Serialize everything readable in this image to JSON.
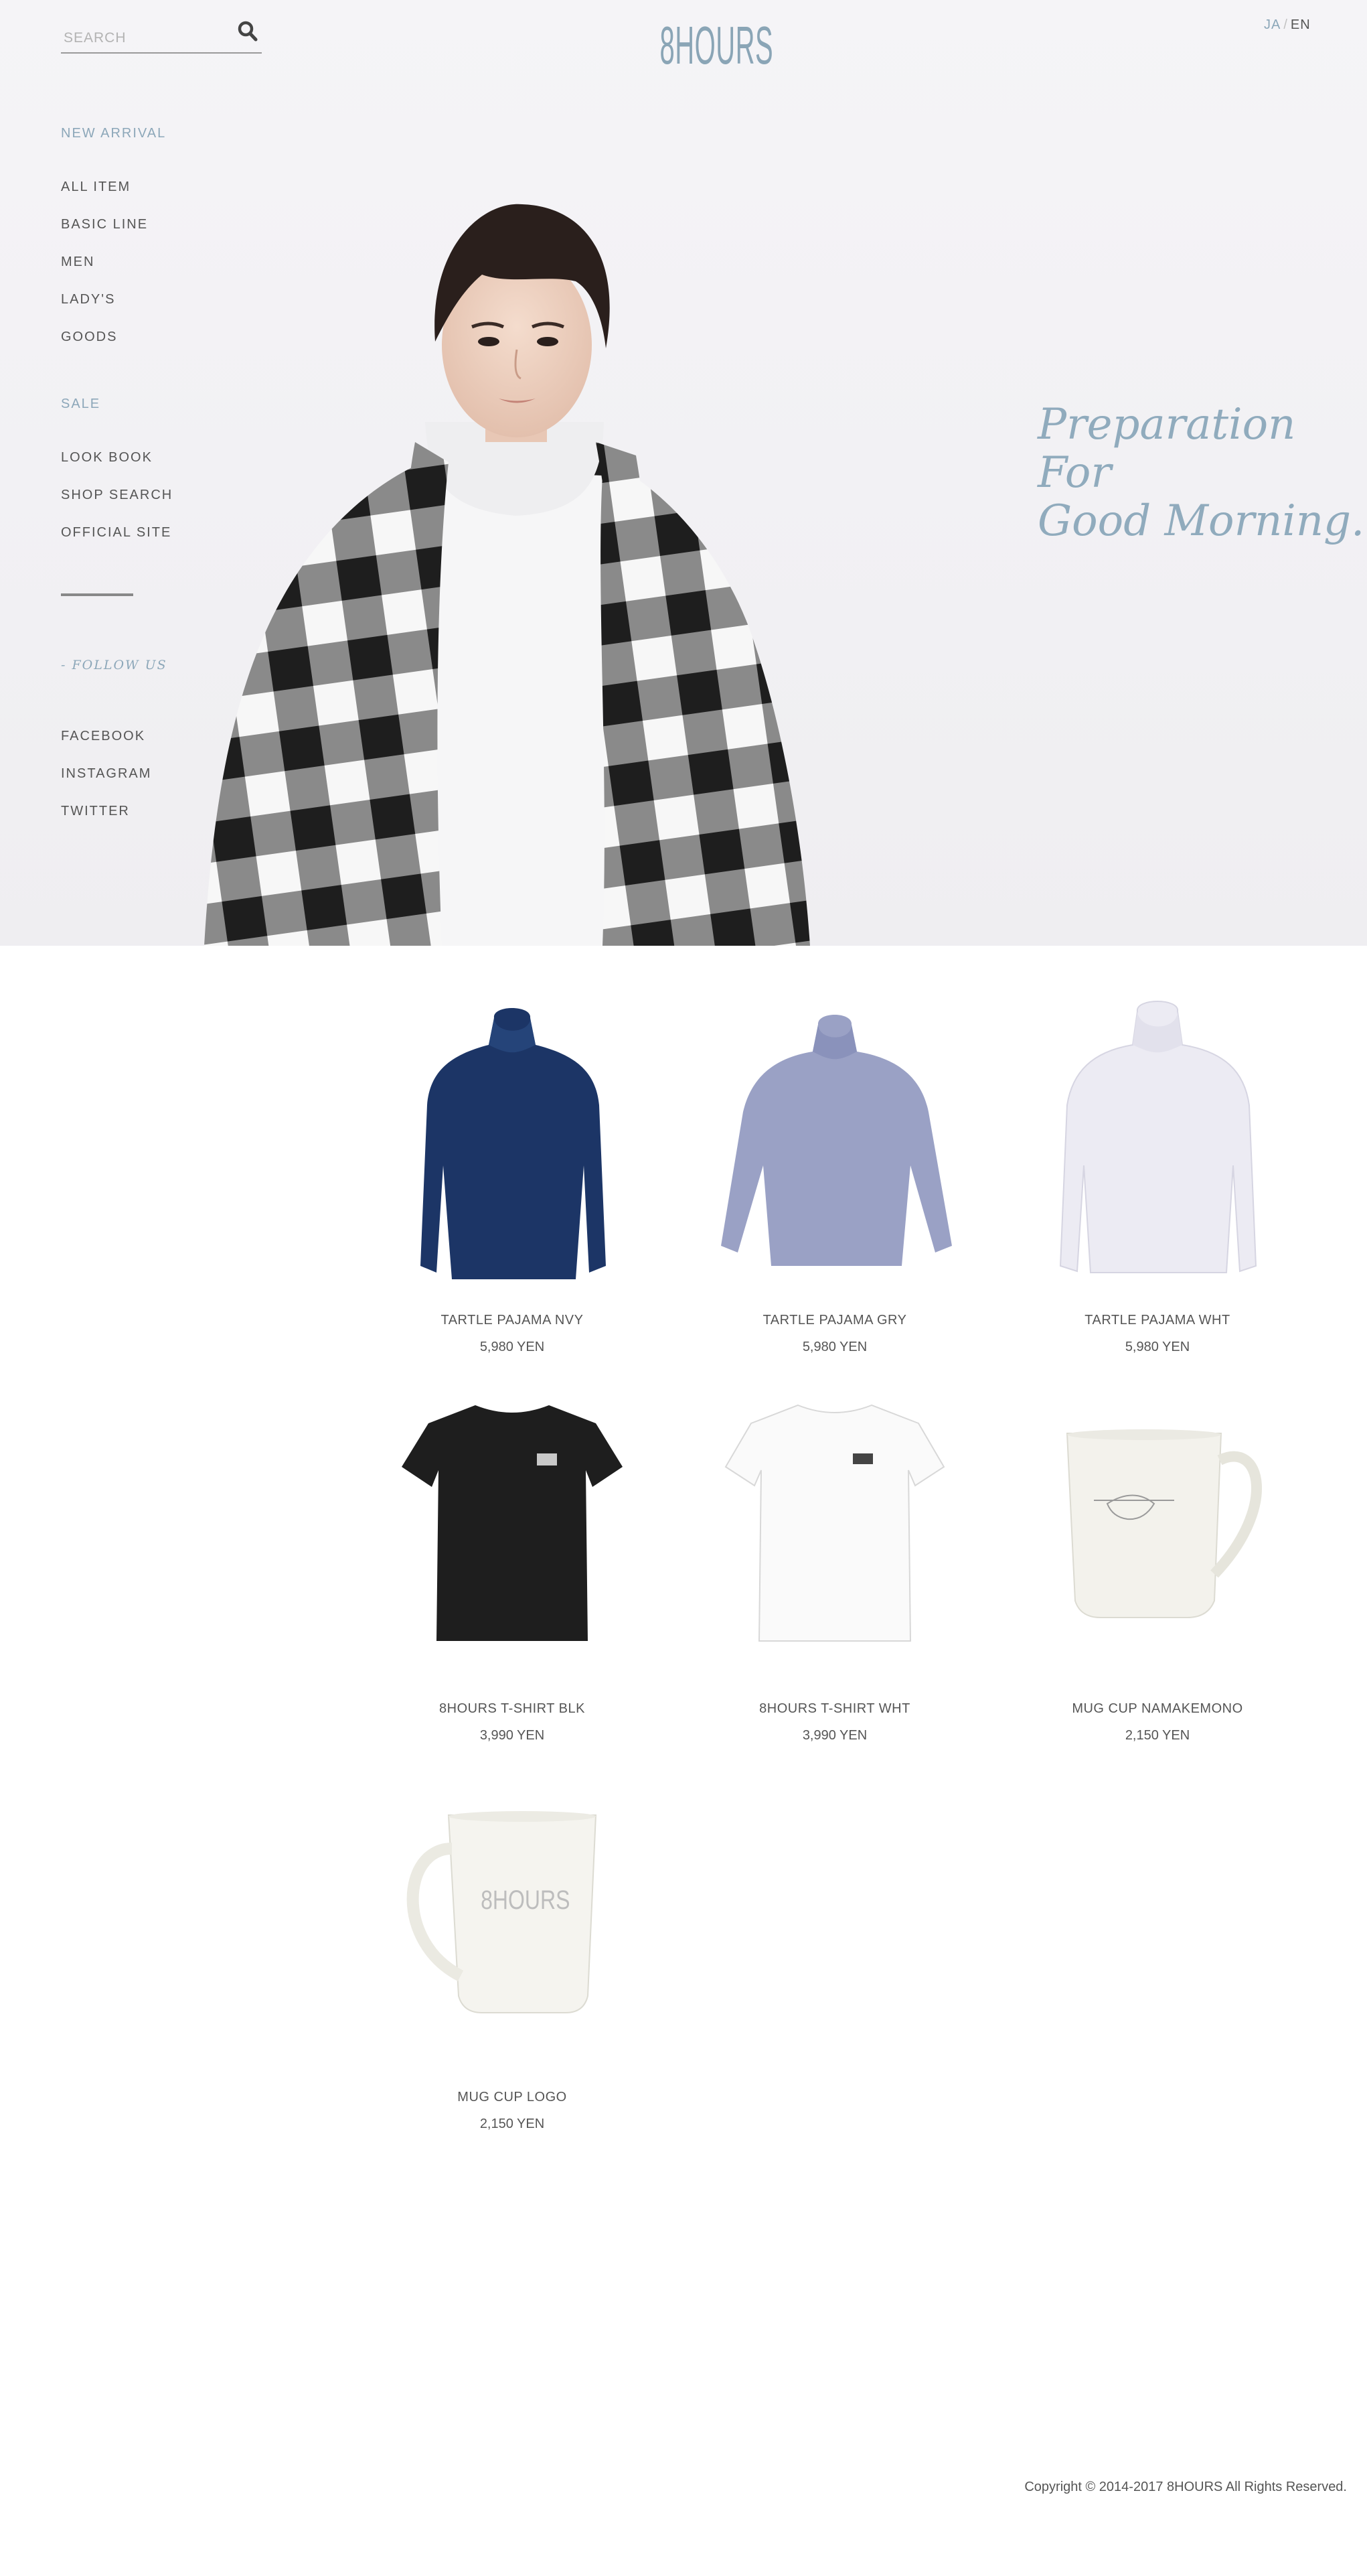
{
  "header": {
    "search_placeholder": "SEARCH",
    "logo_text": "8HOURS",
    "lang_ja": "JA",
    "lang_sep": "/",
    "lang_en": "EN"
  },
  "sidebar": {
    "new_arrival": "NEW ARRIVAL",
    "items": [
      "ALL ITEM",
      "BASIC LINE",
      "MEN",
      "LADY'S",
      "GOODS"
    ],
    "sale": "SALE",
    "links": [
      "LOOK BOOK",
      "SHOP SEARCH",
      "OFFICIAL SITE"
    ],
    "follow_us": "- FOLLOW US",
    "social": [
      "FACEBOOK",
      "INSTAGRAM",
      "TWITTER"
    ]
  },
  "hero": {
    "tagline_lines": [
      "Preparation",
      "For",
      "Good Morning."
    ]
  },
  "products": [
    {
      "name": "TARTLE PAJAMA NVY",
      "price": "5,980 YEN",
      "image": "navy-turtleneck"
    },
    {
      "name": "TARTLE PAJAMA GRY",
      "price": "5,980 YEN",
      "image": "grey-turtleneck"
    },
    {
      "name": "TARTLE PAJAMA WHT",
      "price": "5,980 YEN",
      "image": "white-turtleneck"
    },
    {
      "name": "8HOURS T-SHIRT BLK",
      "price": "3,990 YEN",
      "image": "black-tshirt"
    },
    {
      "name": "8HOURS T-SHIRT WHT",
      "price": "3,990 YEN",
      "image": "white-tshirt"
    },
    {
      "name": "MUG CUP NAMAKEMONO",
      "price": "2,150 YEN",
      "image": "sloth-mug"
    },
    {
      "name": "MUG CUP LOGO",
      "price": "2,150 YEN",
      "image": "logo-mug"
    }
  ],
  "footer": {
    "copyright": "Copyright © 2014-2017 8HOURS All Rights Reserved."
  },
  "colors": {
    "accent": "#8ca7b9",
    "text": "#555555",
    "hero_bg": "#f2f1f4"
  }
}
